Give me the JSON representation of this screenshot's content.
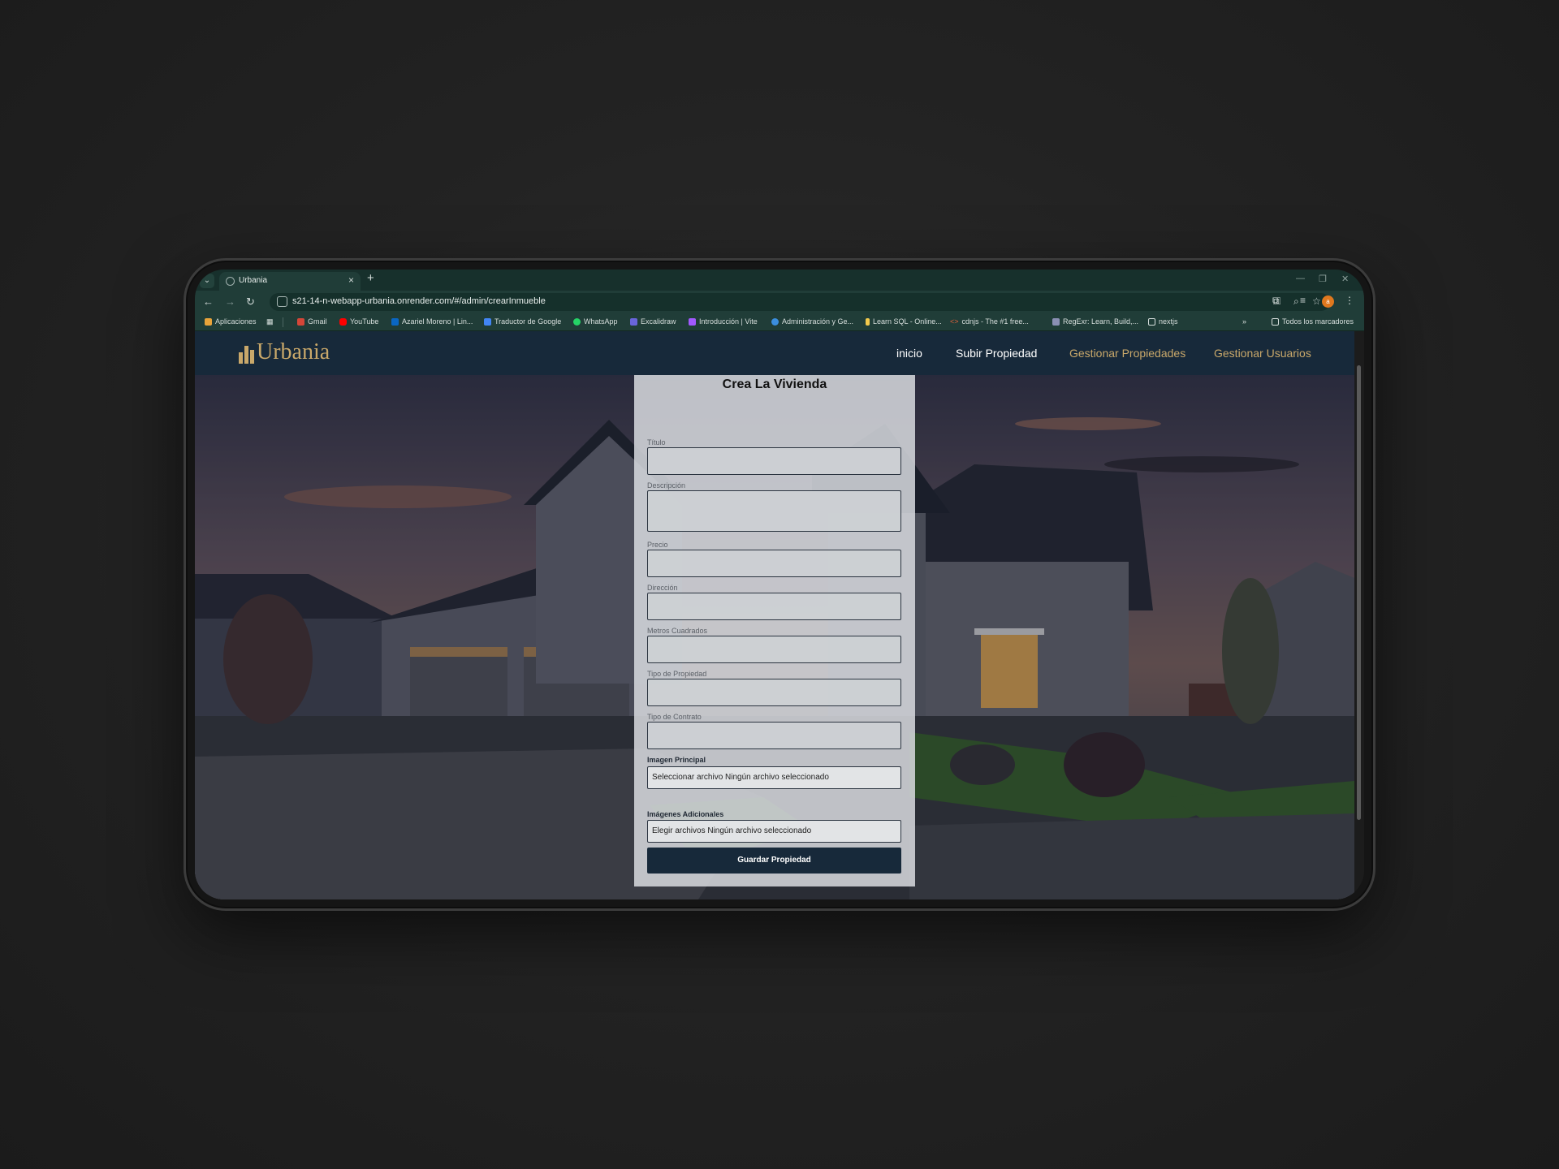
{
  "browser": {
    "tab_title": "Urbania",
    "url": "s21-14-n-webapp-urbania.onrender.com/#/admin/crearInmueble",
    "avatar_letter": "a",
    "bookmarks": [
      "Aplicaciones",
      "Gmail",
      "YouTube",
      "Azariel Moreno | Lin...",
      "Traductor de Google",
      "WhatsApp",
      "Excalidraw",
      "Introducción | Vite",
      "Administración y Ge...",
      "Learn SQL - Online...",
      "cdnjs - The #1 free...",
      "RegExr: Learn, Build,...",
      "nextjs"
    ],
    "all_bookmarks": "Todos los marcadores",
    "overflow": "»"
  },
  "site": {
    "logo": "Urbania",
    "nav": [
      "inicio",
      "Subir Propiedad",
      "Gestionar Propiedades",
      "Gestionar Usuarios"
    ],
    "colors": {
      "nav_bg": "#17293a",
      "gold": "#c9a86a",
      "white": "#ffffff"
    }
  },
  "form": {
    "title": "Crea La Vivienda",
    "fields": [
      "Título",
      "Descripción",
      "Precio",
      "Dirección",
      "Metros Cuadrados",
      "Tipo de Propiedad",
      "Tipo de Contrato"
    ],
    "main_image_label": "Imagen Principal",
    "main_image_value": "Seleccionar archivo Ningún archivo seleccionado",
    "extra_images_label": "Imágenes Adicionales",
    "extra_images_value": "Elegir archivos Ningún archivo seleccionado",
    "submit": "Guardar Propiedad"
  }
}
